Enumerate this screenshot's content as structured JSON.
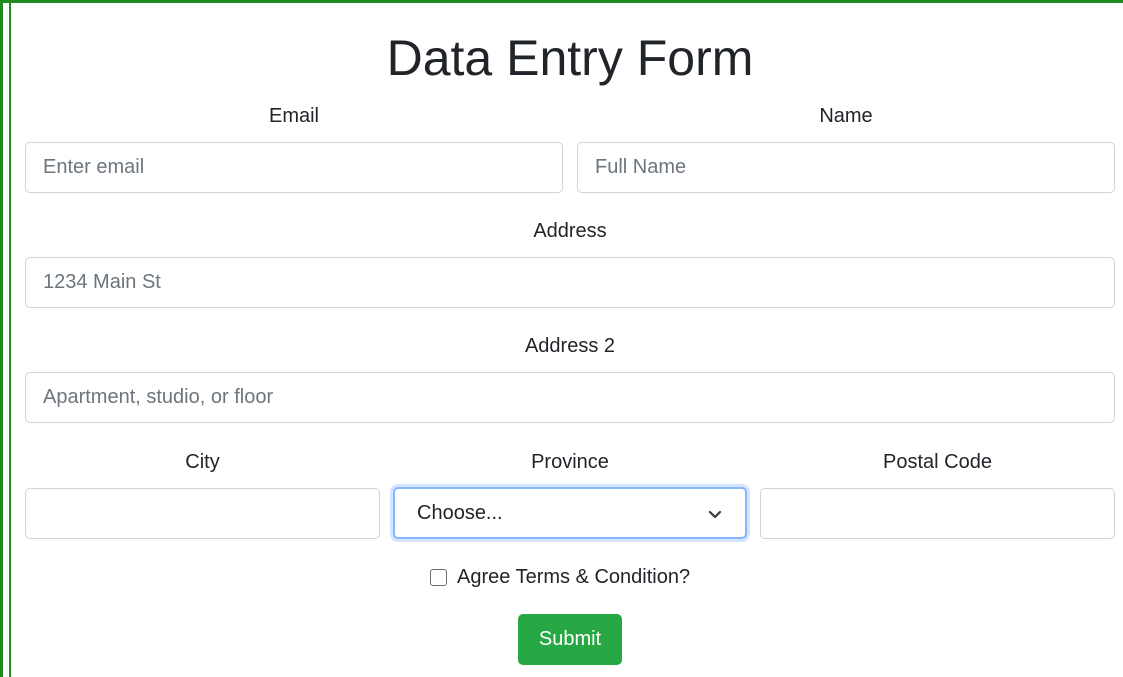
{
  "form": {
    "title": "Data Entry Form",
    "email": {
      "label": "Email",
      "placeholder": "Enter email",
      "value": ""
    },
    "name": {
      "label": "Name",
      "placeholder": "Full Name",
      "value": ""
    },
    "address": {
      "label": "Address",
      "placeholder": "1234 Main St",
      "value": ""
    },
    "address2": {
      "label": "Address 2",
      "placeholder": "Apartment, studio, or floor",
      "value": ""
    },
    "city": {
      "label": "City",
      "value": ""
    },
    "province": {
      "label": "Province",
      "selected": "Choose...",
      "focused": true
    },
    "postal_code": {
      "label": "Postal Code",
      "value": ""
    },
    "terms": {
      "label": "Agree Terms & Condition?",
      "checked": false
    },
    "submit_label": "Submit"
  },
  "colors": {
    "frame_border": "#1e8b1e",
    "submit_bg": "#28a745",
    "focus_border": "#86b7fe",
    "input_border": "#ced4da"
  },
  "icons": {
    "select_arrow": "chevron-down-icon"
  }
}
